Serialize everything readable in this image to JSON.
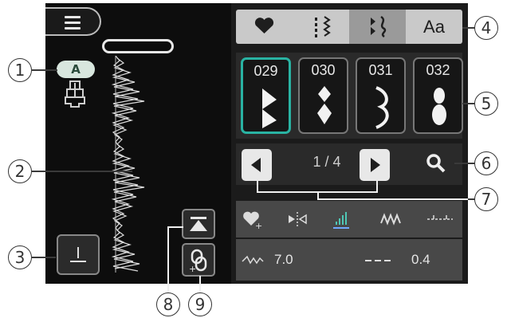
{
  "left_panel": {
    "menu_icon": "hamburger-icon",
    "presser_foot_label": "A",
    "presser_foot_icon": "presser-foot-icon",
    "needle_icon": "needle-position-icon",
    "move_to_top_icon": "move-to-top-icon",
    "link_icon": "link-stitch-icon"
  },
  "tabs": [
    {
      "label": "",
      "icon": "heart-icon"
    },
    {
      "label": "",
      "icon": "utility-stitch-icon"
    },
    {
      "label": "",
      "icon": "decorative-stitch-icon"
    },
    {
      "label": "Aa",
      "icon": "letter-icon"
    }
  ],
  "stitches": [
    {
      "number": "029",
      "icon": "arrow-stitch-icon",
      "selected": true
    },
    {
      "number": "030",
      "icon": "diamond-stitch-icon",
      "selected": false
    },
    {
      "number": "031",
      "icon": "wave-stitch-icon",
      "selected": false
    },
    {
      "number": "032",
      "icon": "oval-stitch-icon",
      "selected": false
    }
  ],
  "pager": {
    "text": "1 / 4",
    "prev_icon": "arrow-left-icon",
    "next_icon": "arrow-right-icon",
    "search_icon": "search-icon"
  },
  "settings_icons": [
    "heart-plus-icon",
    "mirror-icon",
    "length-icon",
    "width-icon",
    "reverse-icon"
  ],
  "values": {
    "width": "7.0",
    "length": "0.4",
    "width_icon": "zigzag-width-icon",
    "length_icon": "stitch-length-icon"
  },
  "callouts": [
    "1",
    "2",
    "3",
    "4",
    "5",
    "6",
    "7",
    "8",
    "9"
  ],
  "colors": {
    "selected_border": "#29b3a3",
    "screen_bg": "#111111",
    "tab_bg": "#c9c9c9"
  }
}
